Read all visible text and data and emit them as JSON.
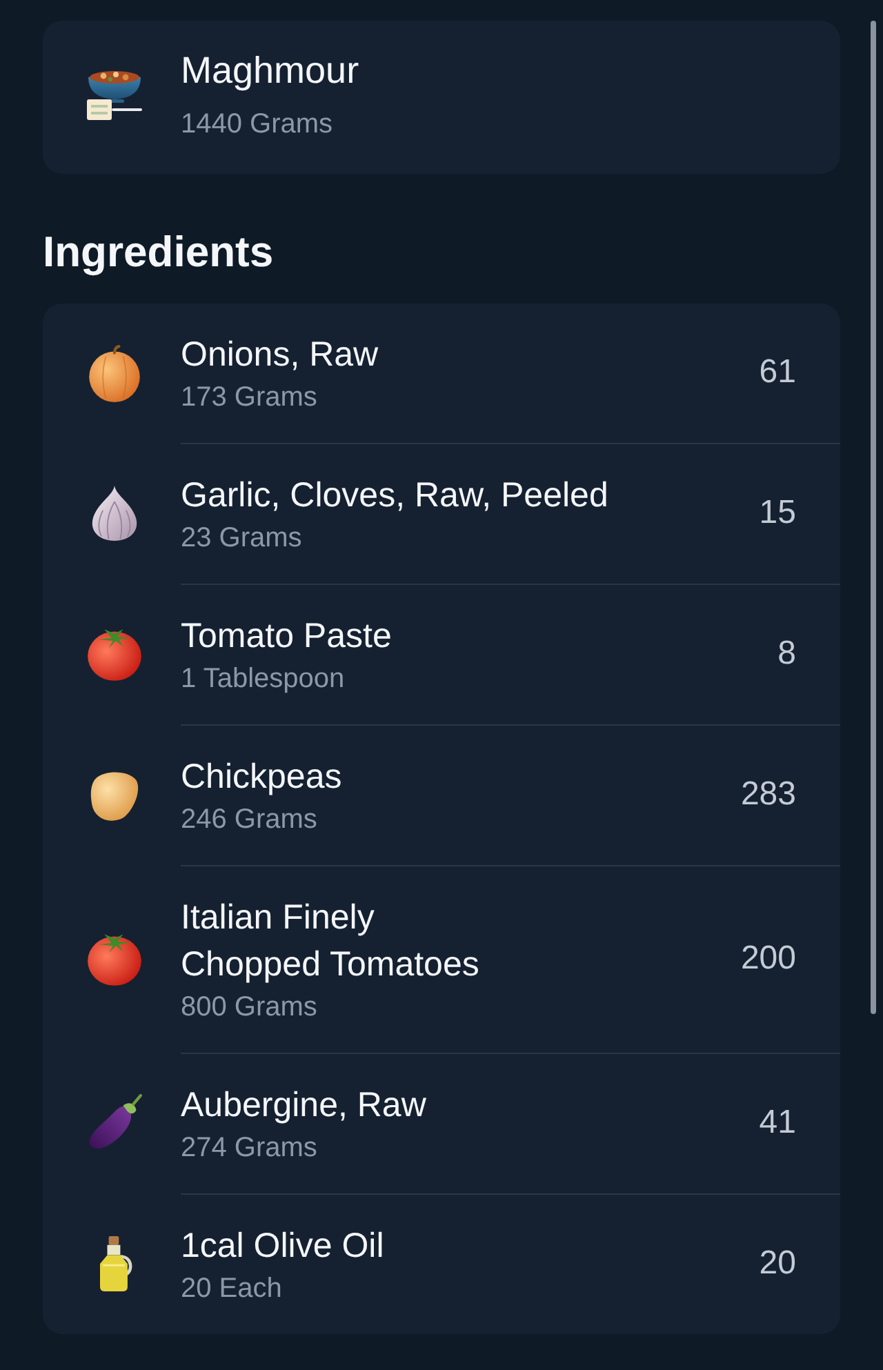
{
  "recipe": {
    "name": "Maghmour",
    "amount": "1440 Grams"
  },
  "section_title": "Ingredients",
  "ingredients": [
    {
      "kind": "onion",
      "name": "Onions, Raw",
      "amount": "173 Grams",
      "value": "61"
    },
    {
      "kind": "garlic",
      "name": "Garlic, Cloves, Raw, Peeled",
      "amount": "23 Grams",
      "value": "15"
    },
    {
      "kind": "tomato",
      "name": "Tomato Paste",
      "amount": "1 Tablespoon",
      "value": "8"
    },
    {
      "kind": "chickpea",
      "name": "Chickpeas",
      "amount": "246 Grams",
      "value": "283"
    },
    {
      "kind": "tomato",
      "name": "Italian Finely Chopped Tomatoes",
      "amount": "800 Grams",
      "value": "200"
    },
    {
      "kind": "aubergine",
      "name": "Aubergine, Raw",
      "amount": "274 Grams",
      "value": "41"
    },
    {
      "kind": "oil",
      "name": "1cal Olive Oil",
      "amount": "20 Each",
      "value": "20"
    }
  ]
}
